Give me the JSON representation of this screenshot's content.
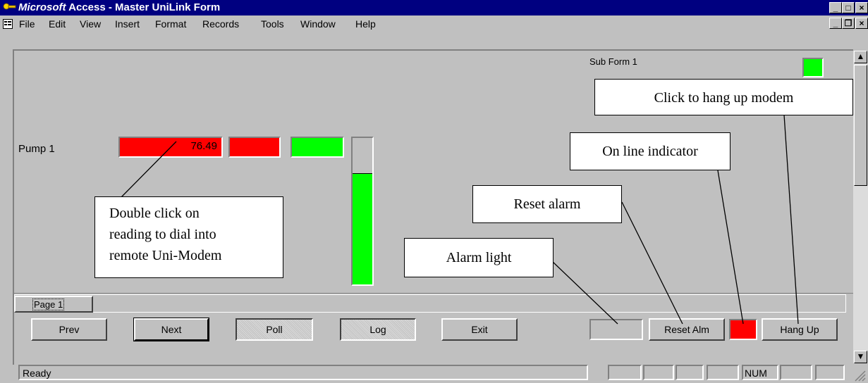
{
  "window": {
    "title_italic": "Microsoft",
    "title_rest": " Access - Master UniLink Form",
    "min_glyph": "_",
    "max_glyph": "□",
    "close_glyph": "×",
    "restore_glyph": "❐"
  },
  "menu": {
    "items": [
      "File",
      "Edit",
      "View",
      "Insert",
      "Format",
      "Records",
      "Tools",
      "Window",
      "Help"
    ]
  },
  "form": {
    "subform_label": "Sub Form 1",
    "pump_label": "Pump 1",
    "reading_value": "76.49",
    "level_percent": 72,
    "colors": {
      "alarm_red": "#ff0000",
      "ok_green": "#00ff00"
    }
  },
  "tabs": {
    "page1": "Page 1"
  },
  "buttons": {
    "prev": "Prev",
    "next": "Next",
    "poll": "Poll",
    "log": "Log",
    "exit": "Exit",
    "reset_alm": "Reset Alm",
    "hang_up": "Hang Up"
  },
  "callouts": {
    "hang_up": "Click to hang up modem",
    "online": "On line indicator",
    "reset": "Reset alarm",
    "alarm": "Alarm light",
    "dial_line1": "Double click on",
    "dial_line2": "reading to dial into",
    "dial_line3": "remote Uni-Modem"
  },
  "status": {
    "text": "Ready",
    "num": "NUM"
  }
}
